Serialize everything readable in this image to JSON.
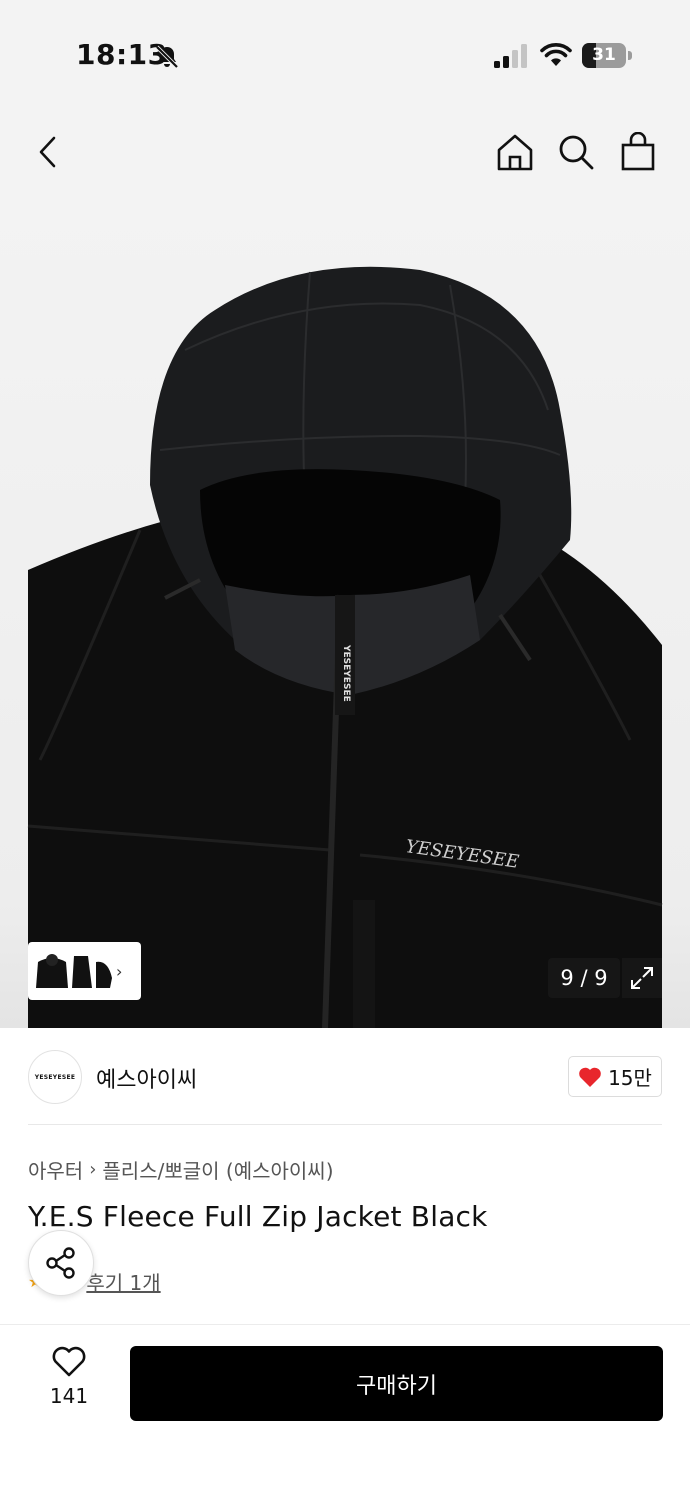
{
  "status_bar": {
    "time": "18:13",
    "battery_level": "31",
    "icons": [
      "bell-off-icon",
      "cellular-signal-icon",
      "wifi-icon",
      "battery-icon"
    ]
  },
  "nav": {
    "icons": [
      "back-chevron-icon",
      "home-icon",
      "search-icon",
      "shopping-bag-icon"
    ]
  },
  "gallery": {
    "counter": "9 / 9",
    "current_image": 9,
    "total_images": 9,
    "print_text": "YESEYESEE",
    "tag_text": "YESEYESEE"
  },
  "brand": {
    "logo_text": "YESEYESEE",
    "name": "예스아이씨",
    "likes": "15만",
    "like_color": "#e8262c"
  },
  "product": {
    "breadcrumb": [
      "아우터",
      "플리스/뽀글이 (예스아이씨)"
    ],
    "title": "Y.E.S Fleece Full Zip Jacket Black",
    "review_text": "후기 1개",
    "review_text_visible": "후기 1개"
  },
  "bottom_bar": {
    "wish_count": "141",
    "buy_label": "구매하기"
  },
  "colors": {
    "accent": "#000000",
    "heart": "#e8262c",
    "background": "#ffffff",
    "image_background": "#f3f3f3"
  }
}
